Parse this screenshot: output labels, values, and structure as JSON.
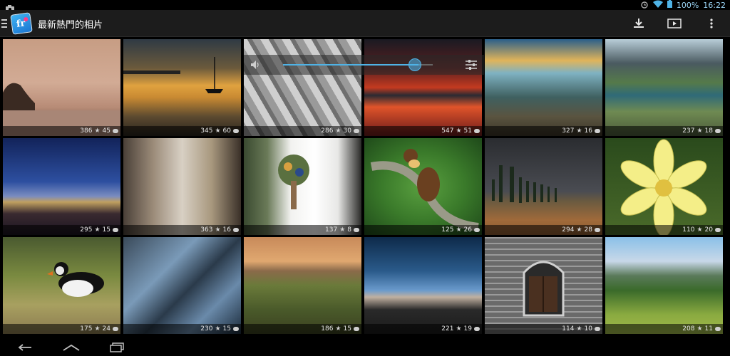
{
  "status": {
    "battery": "100%",
    "time": "16:22"
  },
  "header": {
    "title": "最新熱門的相片"
  },
  "actions": [
    {
      "name": "download-icon"
    },
    {
      "name": "slideshow-play-icon"
    },
    {
      "name": "overflow-menu-icon"
    }
  ],
  "grid": [
    {
      "favs": "386",
      "comments": "45"
    },
    {
      "favs": "345",
      "comments": "60"
    },
    {
      "favs": "286",
      "comments": "30"
    },
    {
      "favs": "547",
      "comments": "51"
    },
    {
      "favs": "327",
      "comments": "16"
    },
    {
      "favs": "237",
      "comments": "18"
    },
    {
      "favs": "295",
      "comments": "15"
    },
    {
      "favs": "363",
      "comments": "16"
    },
    {
      "favs": "137",
      "comments": "8"
    },
    {
      "favs": "125",
      "comments": "26"
    },
    {
      "favs": "294",
      "comments": "28"
    },
    {
      "favs": "110",
      "comments": "20"
    },
    {
      "favs": "175",
      "comments": "24"
    },
    {
      "favs": "230",
      "comments": "15"
    },
    {
      "favs": "186",
      "comments": "15"
    },
    {
      "favs": "221",
      "comments": "19"
    },
    {
      "favs": "114",
      "comments": "10"
    },
    {
      "favs": "208",
      "comments": "11"
    }
  ],
  "volume": {
    "level": 0.85
  },
  "colors": {
    "accent": "#4fb3e6",
    "action_bar": "#1c1c1c"
  }
}
